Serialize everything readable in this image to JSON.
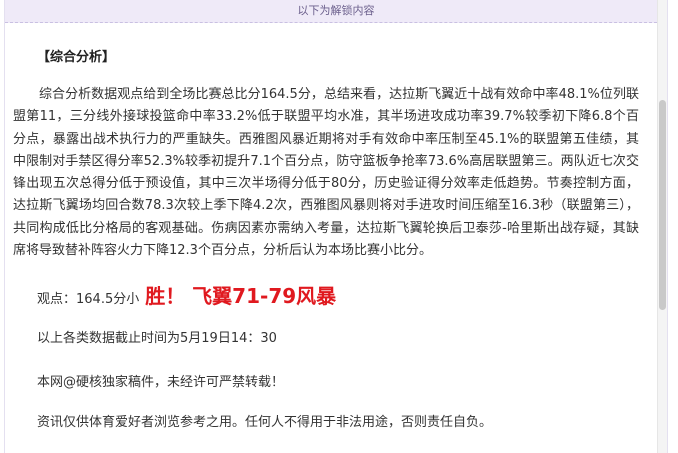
{
  "unlock_banner": "以下为解锁内容",
  "section_heading": "【综合分析】",
  "analysis_paragraph": "综合分析数据观点给到全场比赛总比分164.5分，总结来看，达拉斯飞翼近十战有效命中率48.1%位列联盟第11，三分线外接球投篮命中率33.2%低于联盟平均水准，其半场进攻成功率39.7%较季初下降6.8个百分点，暴露出战术执行力的严重缺失。西雅图风暴近期将对手有效命中率压制至45.1%的联盟第五佳绩，其中限制对手禁区得分率52.3%较季初提升7.1个百分点，防守篮板争抢率73.6%高居联盟第三。两队近七次交锋出现五次总得分低于预设值，其中三次半场得分低于80分，历史验证得分效率走低趋势。节奏控制方面，达拉斯飞翼场均回合数78.3次较上季下降4.2次，西雅图风暴则将对手进攻时间压缩至16.3秒（联盟第三），共同构成低比分格局的客观基础。伤病因素亦需纳入考量，达拉斯飞翼轮换后卫泰莎-哈里斯出战存疑，其缺席将导致替补阵容火力下降12.3个百分点，分析后认为本场比赛小比分。",
  "verdict": {
    "label": "观点：164.5分小",
    "result": "胜！ 飞翼71-79风暴"
  },
  "data_cutoff": "以上各类数据截止时间为5月19日14：30",
  "copyright_notice": "本网@硬核独家稿件，未经许可严禁转载！",
  "disclaimer": "资讯仅供体育爱好者浏览参考之用。任何人不得用于非法用途，否则责任自负。",
  "colors": {
    "accent_red": "#e0191f",
    "banner_bg": "#efeaf8",
    "banner_text": "#6b5f8c"
  }
}
